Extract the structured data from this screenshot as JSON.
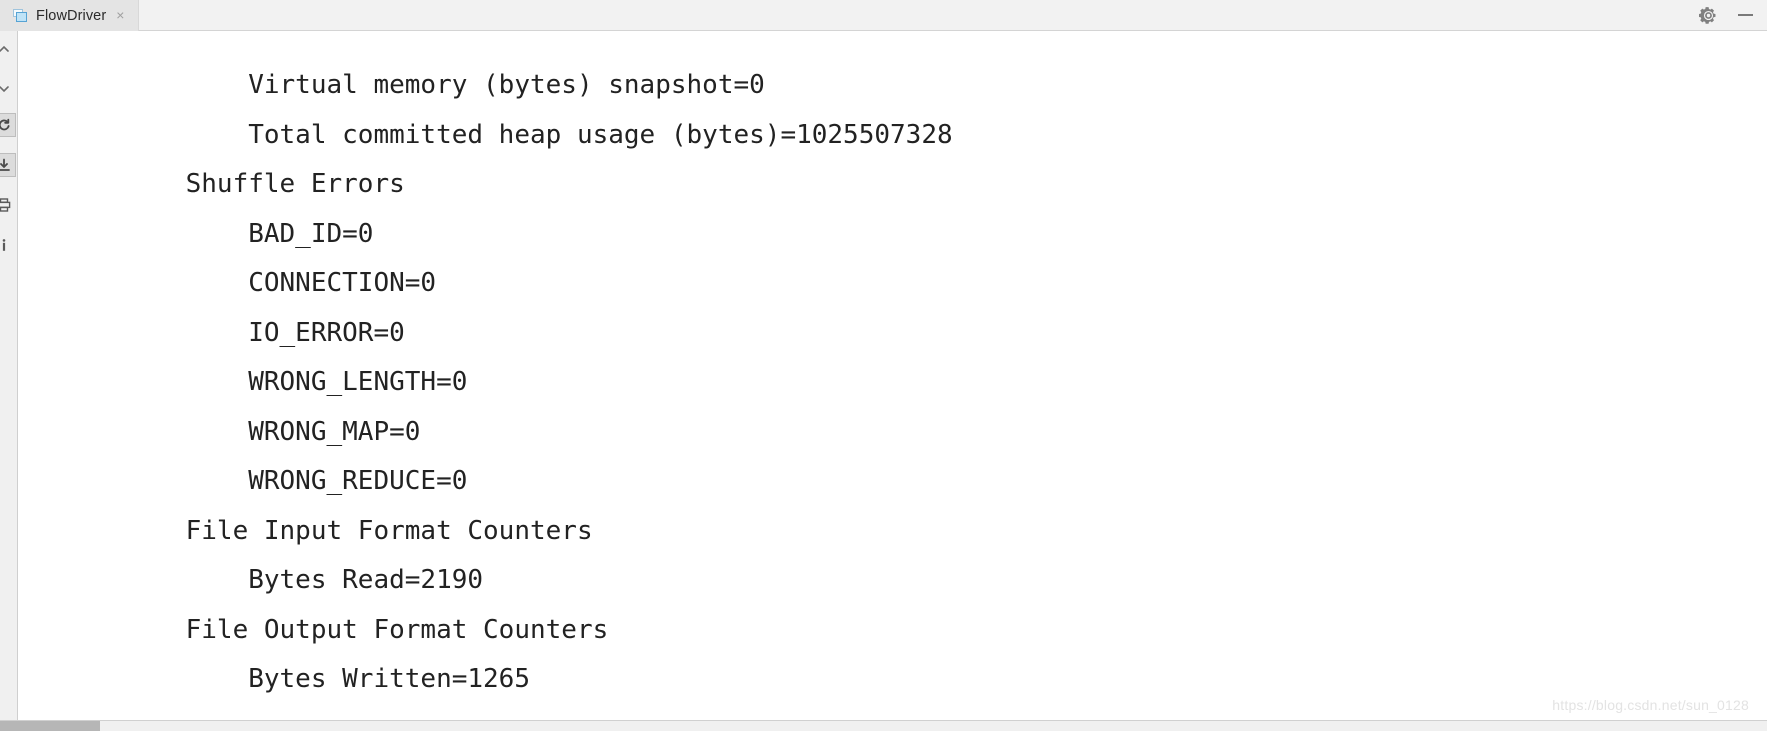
{
  "window": {
    "tab": {
      "label": "FlowDriver",
      "icon": "document-window-icon",
      "close_label": "×"
    },
    "controls": {
      "settings_label": "gear-icon",
      "minimize_label": "minimize-icon"
    }
  },
  "sidebar": {
    "items": [
      {
        "name": "chevron-up-icon",
        "label": "^"
      },
      {
        "name": "chevron-down-icon",
        "label": "v"
      },
      {
        "name": "rerun-icon",
        "label": "↺"
      },
      {
        "name": "download-icon",
        "label": "↓"
      },
      {
        "name": "print-icon",
        "label": "⎙"
      },
      {
        "name": "info-icon",
        "label": "i"
      }
    ]
  },
  "console": {
    "lines": [
      "        Virtual memory (bytes) snapshot=0",
      "        Total committed heap usage (bytes)=1025507328",
      "    Shuffle Errors",
      "        BAD_ID=0",
      "        CONNECTION=0",
      "        IO_ERROR=0",
      "        WRONG_LENGTH=0",
      "        WRONG_MAP=0",
      "        WRONG_REDUCE=0",
      "    File Input Format Counters",
      "        Bytes Read=2190",
      "    File Output Format Counters",
      "        Bytes Written=1265"
    ]
  },
  "watermark": {
    "text": "https://blog.csdn.net/sun_0128"
  },
  "colors": {
    "tab_active_bg": "#e4e4e4",
    "tabbar_bg": "#f2f2f2",
    "rail_bg": "#f0f0f0",
    "editor_bg": "#ffffff",
    "text": "#222222",
    "watermark": "#e3e3e3",
    "tab_icon_accent": "#56a3d4"
  }
}
